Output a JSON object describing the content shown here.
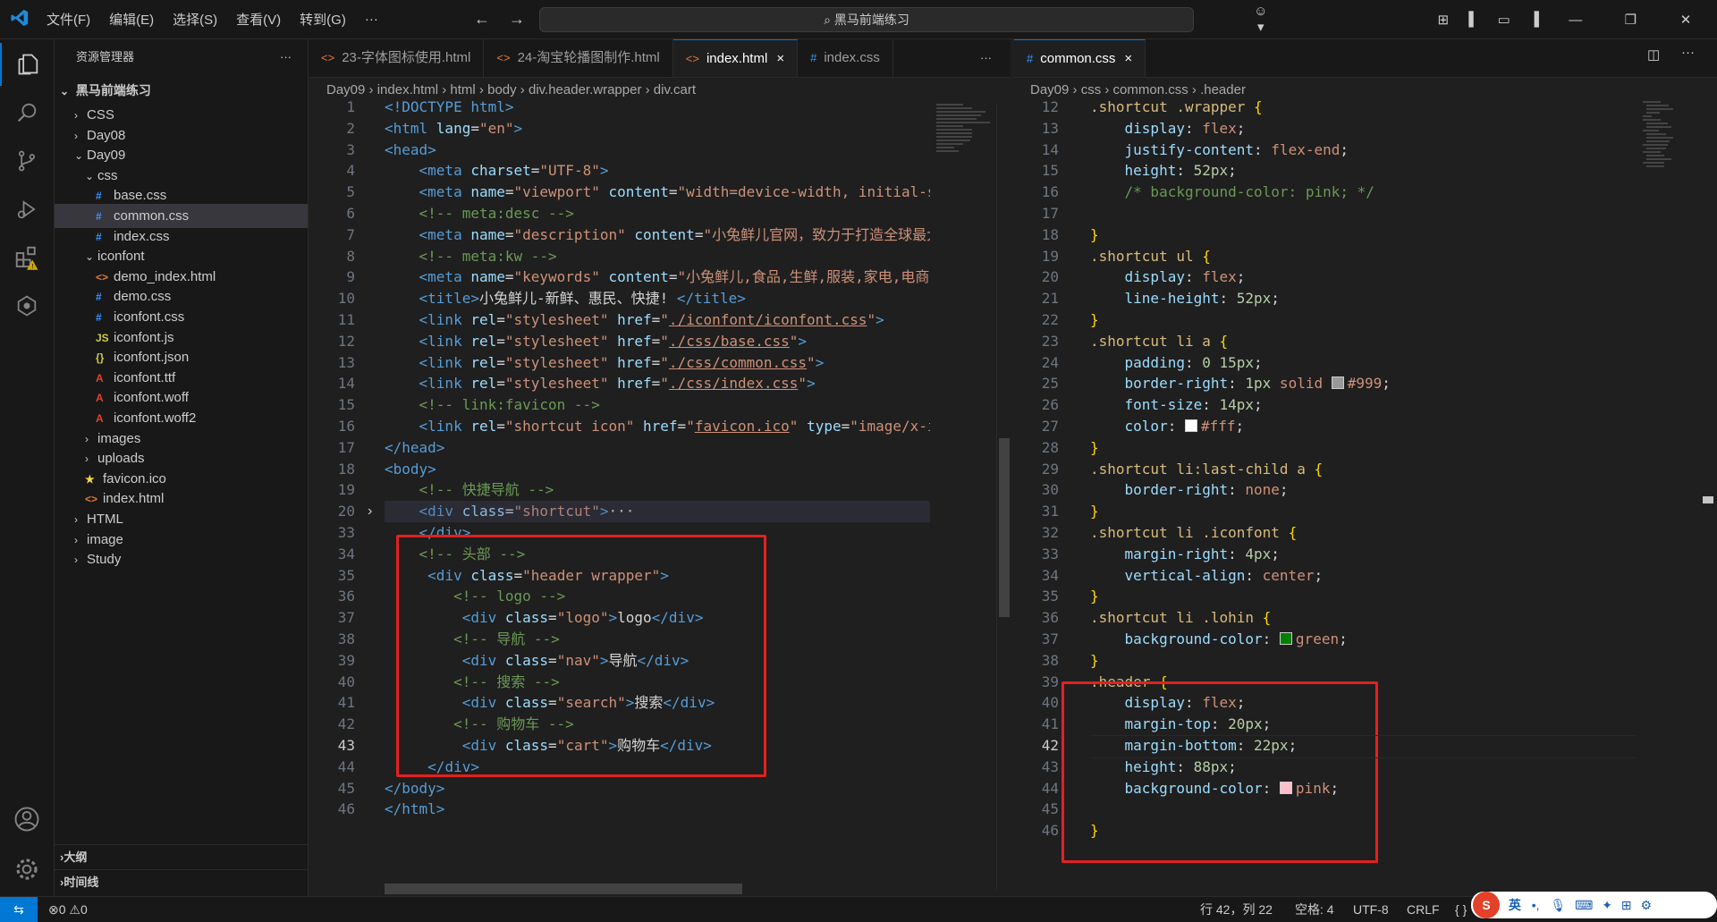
{
  "titlebar": {
    "menus": [
      "文件(F)",
      "编辑(E)",
      "选择(S)",
      "查看(V)",
      "转到(G)",
      "···"
    ],
    "search_text": "黑马前端练习",
    "nav_back": "←",
    "nav_forward": "→"
  },
  "sidebar": {
    "title": "资源管理器",
    "more": "···",
    "root": "黑马前端练习",
    "tree": [
      {
        "label": "CSS",
        "kind": "folder",
        "open": false,
        "depth": 1
      },
      {
        "label": "Day08",
        "kind": "folder",
        "open": false,
        "depth": 1
      },
      {
        "label": "Day09",
        "kind": "folder",
        "open": true,
        "depth": 1
      },
      {
        "label": "css",
        "kind": "folder",
        "open": true,
        "depth": 2
      },
      {
        "label": "base.css",
        "kind": "css",
        "depth": 3
      },
      {
        "label": "common.css",
        "kind": "css",
        "depth": 3,
        "selected": true
      },
      {
        "label": "index.css",
        "kind": "css",
        "depth": 3
      },
      {
        "label": "iconfont",
        "kind": "folder",
        "open": true,
        "depth": 2
      },
      {
        "label": "demo_index.html",
        "kind": "html",
        "depth": 3
      },
      {
        "label": "demo.css",
        "kind": "css",
        "depth": 3
      },
      {
        "label": "iconfont.css",
        "kind": "css",
        "depth": 3
      },
      {
        "label": "iconfont.js",
        "kind": "js",
        "depth": 3
      },
      {
        "label": "iconfont.json",
        "kind": "json",
        "depth": 3
      },
      {
        "label": "iconfont.ttf",
        "kind": "font",
        "depth": 3
      },
      {
        "label": "iconfont.woff",
        "kind": "font",
        "depth": 3
      },
      {
        "label": "iconfont.woff2",
        "kind": "font",
        "depth": 3
      },
      {
        "label": "images",
        "kind": "folder",
        "open": false,
        "depth": 2
      },
      {
        "label": "uploads",
        "kind": "folder",
        "open": false,
        "depth": 2
      },
      {
        "label": "favicon.ico",
        "kind": "ico",
        "depth": 2
      },
      {
        "label": "index.html",
        "kind": "html",
        "depth": 2
      },
      {
        "label": "HTML",
        "kind": "folder",
        "open": false,
        "depth": 1
      },
      {
        "label": "image",
        "kind": "folder",
        "open": false,
        "depth": 1
      },
      {
        "label": "Study",
        "kind": "folder",
        "open": false,
        "depth": 1
      }
    ],
    "outline": "大纲",
    "timeline": "时间线"
  },
  "left_editor": {
    "tabs": [
      {
        "label": "23-字体图标使用.html",
        "icon": "<>",
        "active": false
      },
      {
        "label": "24-淘宝轮播图制作.html",
        "icon": "<>",
        "active": false
      },
      {
        "label": "index.html",
        "icon": "<>",
        "active": true,
        "close": "×"
      },
      {
        "label": "index.css",
        "icon": "#",
        "active": false
      }
    ],
    "more": "···",
    "breadcrumb": [
      "Day09",
      "index.html",
      "html",
      "body",
      "div.header.wrapper",
      "div.cart"
    ],
    "current_line": "43"
  },
  "right_editor": {
    "tabs": [
      {
        "label": "common.css",
        "icon": "#",
        "active": true,
        "close": "×"
      }
    ],
    "breadcrumb": [
      "Day09",
      "css",
      "common.css",
      ".header"
    ],
    "current_line": "42"
  },
  "status": {
    "errors": "0",
    "warnings": "0",
    "position": "行 42，列 22",
    "spaces": "空格: 4",
    "encoding": "UTF-8",
    "eol": "CRLF",
    "lang": "{ }",
    "ime": "英"
  }
}
